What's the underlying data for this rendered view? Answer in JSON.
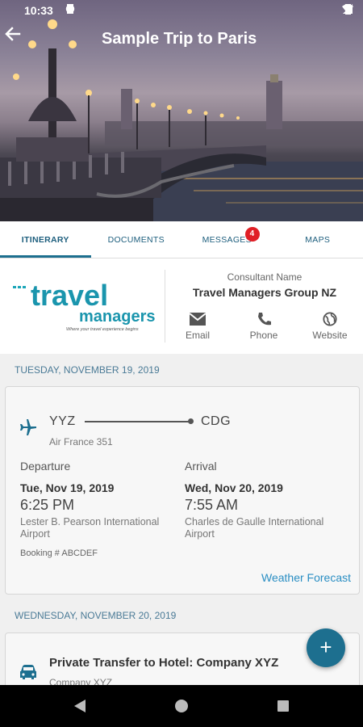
{
  "status_bar": {
    "time": "10:33"
  },
  "header": {
    "title": "Sample Trip to Paris"
  },
  "tabs": [
    {
      "label": "ITINERARY",
      "active": true
    },
    {
      "label": "DOCUMENTS",
      "active": false
    },
    {
      "label": "MESSAGES",
      "active": false,
      "badge": "4"
    },
    {
      "label": "MAPS",
      "active": false
    }
  ],
  "consultant": {
    "logo_text_1": "travel",
    "logo_text_2": "managers",
    "logo_tagline": "Where your travel experience begins",
    "label": "Consultant Name",
    "name": "Travel Managers Group NZ",
    "actions": [
      {
        "label": "Email",
        "icon": "email-icon"
      },
      {
        "label": "Phone",
        "icon": "phone-icon"
      },
      {
        "label": "Website",
        "icon": "globe-icon"
      }
    ]
  },
  "days": [
    {
      "date": "TUESDAY, NOVEMBER 19, 2019"
    },
    {
      "date": "WEDNESDAY, NOVEMBER 20, 2019"
    }
  ],
  "flight": {
    "from": "YYZ",
    "to": "CDG",
    "flight_number": "Air France 351",
    "departure": {
      "label": "Departure",
      "date": "Tue, Nov 19, 2019",
      "time": "6:25 PM",
      "airport": "Lester B. Pearson International Airport"
    },
    "arrival": {
      "label": "Arrival",
      "date": "Wed, Nov 20, 2019",
      "time": "7:55 AM",
      "airport": "Charles de Gaulle International Airport"
    },
    "booking": "Booking # ABCDEF",
    "weather_link": "Weather Forecast"
  },
  "transfer": {
    "title": "Private Transfer to Hotel: Company XYZ",
    "subtitle": "Company XYZ"
  },
  "fab": {
    "label": "+"
  },
  "colors": {
    "accent": "#1d6f8f",
    "link": "#2a8ec3",
    "badge": "#e01f26"
  }
}
